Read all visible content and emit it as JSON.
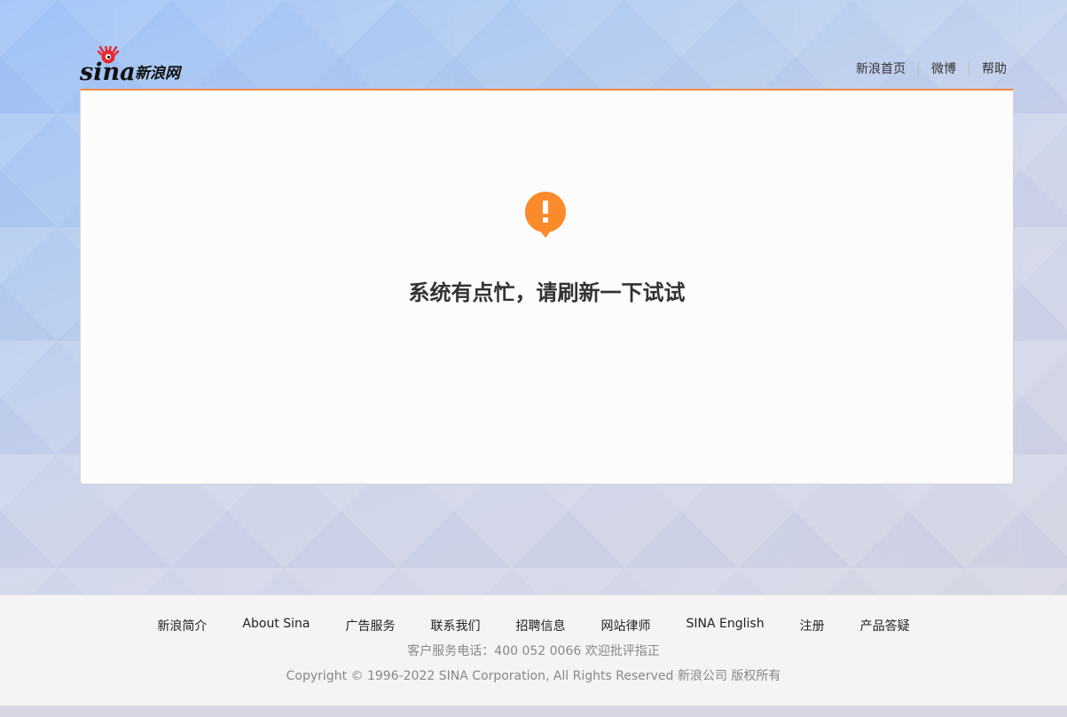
{
  "brand": {
    "logo_text": "sina新浪网",
    "accent_color": "#f08a4b",
    "alert_color": "#fb8a2a"
  },
  "top_nav": {
    "items": [
      "新浪首页",
      "微博",
      "帮助"
    ]
  },
  "main": {
    "icon": "exclamation-icon",
    "message": "系统有点忙，请刷新一下试试"
  },
  "footer": {
    "links": [
      "新浪简介",
      "About Sina",
      "广告服务",
      "联系我们",
      "招聘信息",
      "网站律师",
      "SINA English",
      "注册",
      "产品答疑"
    ],
    "hotline": "客户服务电话：400 052 0066 欢迎批评指正",
    "copyright": "Copyright © 1996-2022 SINA Corporation, All Rights Reserved 新浪公司 版权所有"
  }
}
